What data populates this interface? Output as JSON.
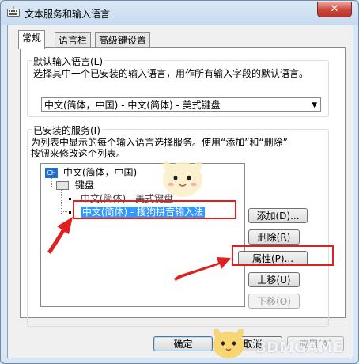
{
  "window": {
    "title": "文本服务和输入语言",
    "close_symbol": "✕",
    "tabs": [
      {
        "label": "常规",
        "active": true
      },
      {
        "label": "语言栏",
        "active": false
      },
      {
        "label": "高级键设置",
        "active": false
      }
    ]
  },
  "default_language": {
    "group_title": "默认输入语言(L)",
    "description": "选择其中一个已安装的输入语言，用作所有输入字段的默认语言。",
    "selected_value": "中文(简体，中国) - 中文(简体) - 美式键盘"
  },
  "installed_services": {
    "group_title": "已安装的服务(I)",
    "description_line1": "为列表中显示的每个输入语言选择服务。使用“添加”和“删除”",
    "description_line2": "按钮来修改这个列表。",
    "tree": {
      "language_badge": "CH",
      "language_label": "中文(简体，中国)",
      "category_label": "键盘",
      "items": [
        {
          "label": "中文(简体) - 美式键盘",
          "selected": false
        },
        {
          "label": "中文(简体) - 搜狗拼音输入法",
          "selected": true
        }
      ]
    },
    "buttons": {
      "add": "添加(D)...",
      "remove": "删除(R)",
      "properties": "属性(P)...",
      "move_up": "上移(U)",
      "move_down": "下移(O)"
    }
  },
  "footer": {
    "ok": "确定",
    "cancel": "取消",
    "apply": "应用(A)"
  },
  "watermark": {
    "text": "3DMGAME"
  },
  "colors": {
    "highlight": "#e02020",
    "selection": "#3399ff",
    "language_badge": "#1f6fd0"
  }
}
